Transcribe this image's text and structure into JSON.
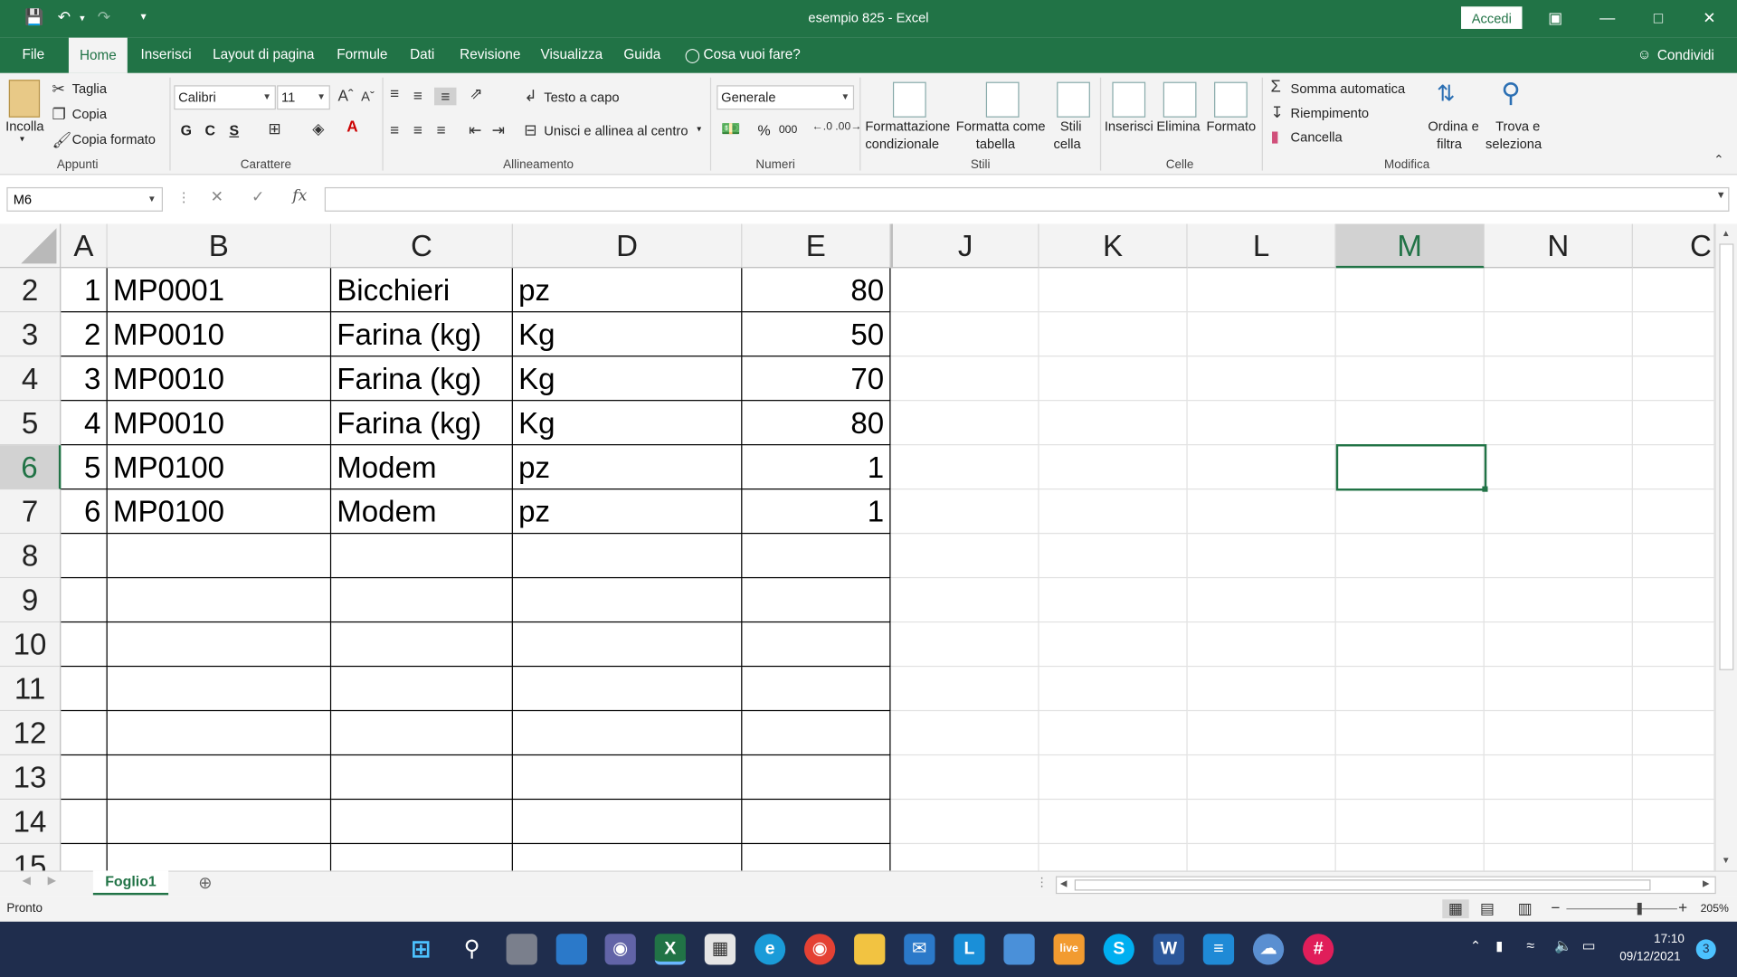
{
  "title": "esempio 825  -  Excel",
  "signin": "Accedi",
  "tabs": [
    "File",
    "Home",
    "Inserisci",
    "Layout di pagina",
    "Formule",
    "Dati",
    "Revisione",
    "Visualizza",
    "Guida"
  ],
  "tell_me": "Cosa vuoi fare?",
  "share": "Condividi",
  "ribbon": {
    "clipboard": {
      "paste": "Incolla",
      "cut": "Taglia",
      "copy": "Copia",
      "format_painter": "Copia formato",
      "label": "Appunti"
    },
    "font": {
      "name": "Calibri",
      "size": "11",
      "bold": "G",
      "italic": "C",
      "underline": "S",
      "label": "Carattere"
    },
    "alignment": {
      "wrap": "Testo a capo",
      "merge": "Unisci e allinea al centro",
      "label": "Allineamento"
    },
    "number": {
      "format": "Generale",
      "percent": "%",
      "thousands": "000",
      "label": "Numeri"
    },
    "styles": {
      "conditional_1": "Formattazione",
      "conditional_2": "condizionale",
      "table_1": "Formatta come",
      "table_2": "tabella",
      "cell_1": "Stili",
      "cell_2": "cella",
      "label": "Stili"
    },
    "cells": {
      "insert": "Inserisci",
      "delete": "Elimina",
      "format": "Formato",
      "label": "Celle"
    },
    "editing": {
      "autosum": "Somma automatica",
      "fill": "Riempimento",
      "clear": "Cancella",
      "sort_1": "Ordina e",
      "sort_2": "filtra",
      "find_1": "Trova e",
      "find_2": "seleziona",
      "label": "Modifica"
    }
  },
  "name_box": "M6",
  "fx": "fx",
  "columns": [
    "A",
    "B",
    "C",
    "D",
    "E",
    "J",
    "K",
    "L",
    "M",
    "N",
    "C"
  ],
  "rows": [
    "2",
    "3",
    "4",
    "5",
    "6",
    "7",
    "8",
    "9",
    "10",
    "11",
    "12",
    "13",
    "14",
    "15"
  ],
  "table": [
    [
      "1",
      "MP0001",
      "Bicchieri",
      "pz",
      "80"
    ],
    [
      "2",
      "MP0010",
      "Farina (kg)",
      "Kg",
      "50"
    ],
    [
      "3",
      "MP0010",
      "Farina (kg)",
      "Kg",
      "70"
    ],
    [
      "4",
      "MP0010",
      "Farina (kg)",
      "Kg",
      "80"
    ],
    [
      "5",
      "MP0100",
      "Modem",
      "pz",
      "1"
    ],
    [
      "6",
      "MP0100",
      "Modem",
      "pz",
      "1"
    ]
  ],
  "sheet_tab": "Foglio1",
  "status": "Pronto",
  "zoom": "205%",
  "clock": {
    "time": "17:10",
    "date": "09/12/2021"
  },
  "notification_count": "3",
  "colors": {
    "accent": "#217346",
    "taskbar": "#1f2d4d"
  }
}
